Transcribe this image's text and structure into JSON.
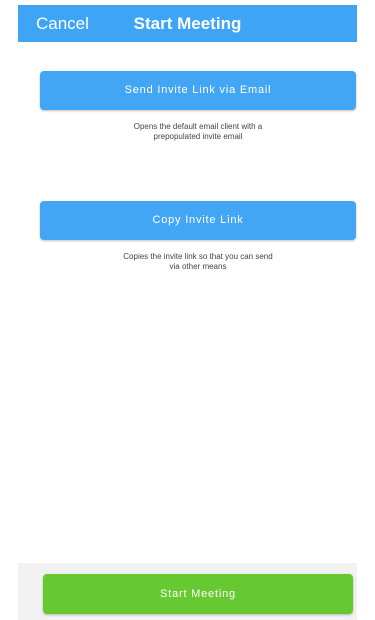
{
  "header": {
    "cancel_label": "Cancel",
    "title": "Start Meeting"
  },
  "actions": {
    "email": {
      "label": "Send Invite Link via Email",
      "hint_line1": "Opens the default email client with a",
      "hint_line2": "prepopulated invite email"
    },
    "copy": {
      "label": "Copy Invite Link",
      "hint_line1": "Copies the invite link so that you can send",
      "hint_line2": "via other means"
    }
  },
  "footer": {
    "start_label": "Start Meeting"
  },
  "colors": {
    "header_blue": "#3ea4f6",
    "button_blue": "#43a6f5",
    "start_green": "#66c932",
    "footer_gray": "#f2f2f2"
  }
}
